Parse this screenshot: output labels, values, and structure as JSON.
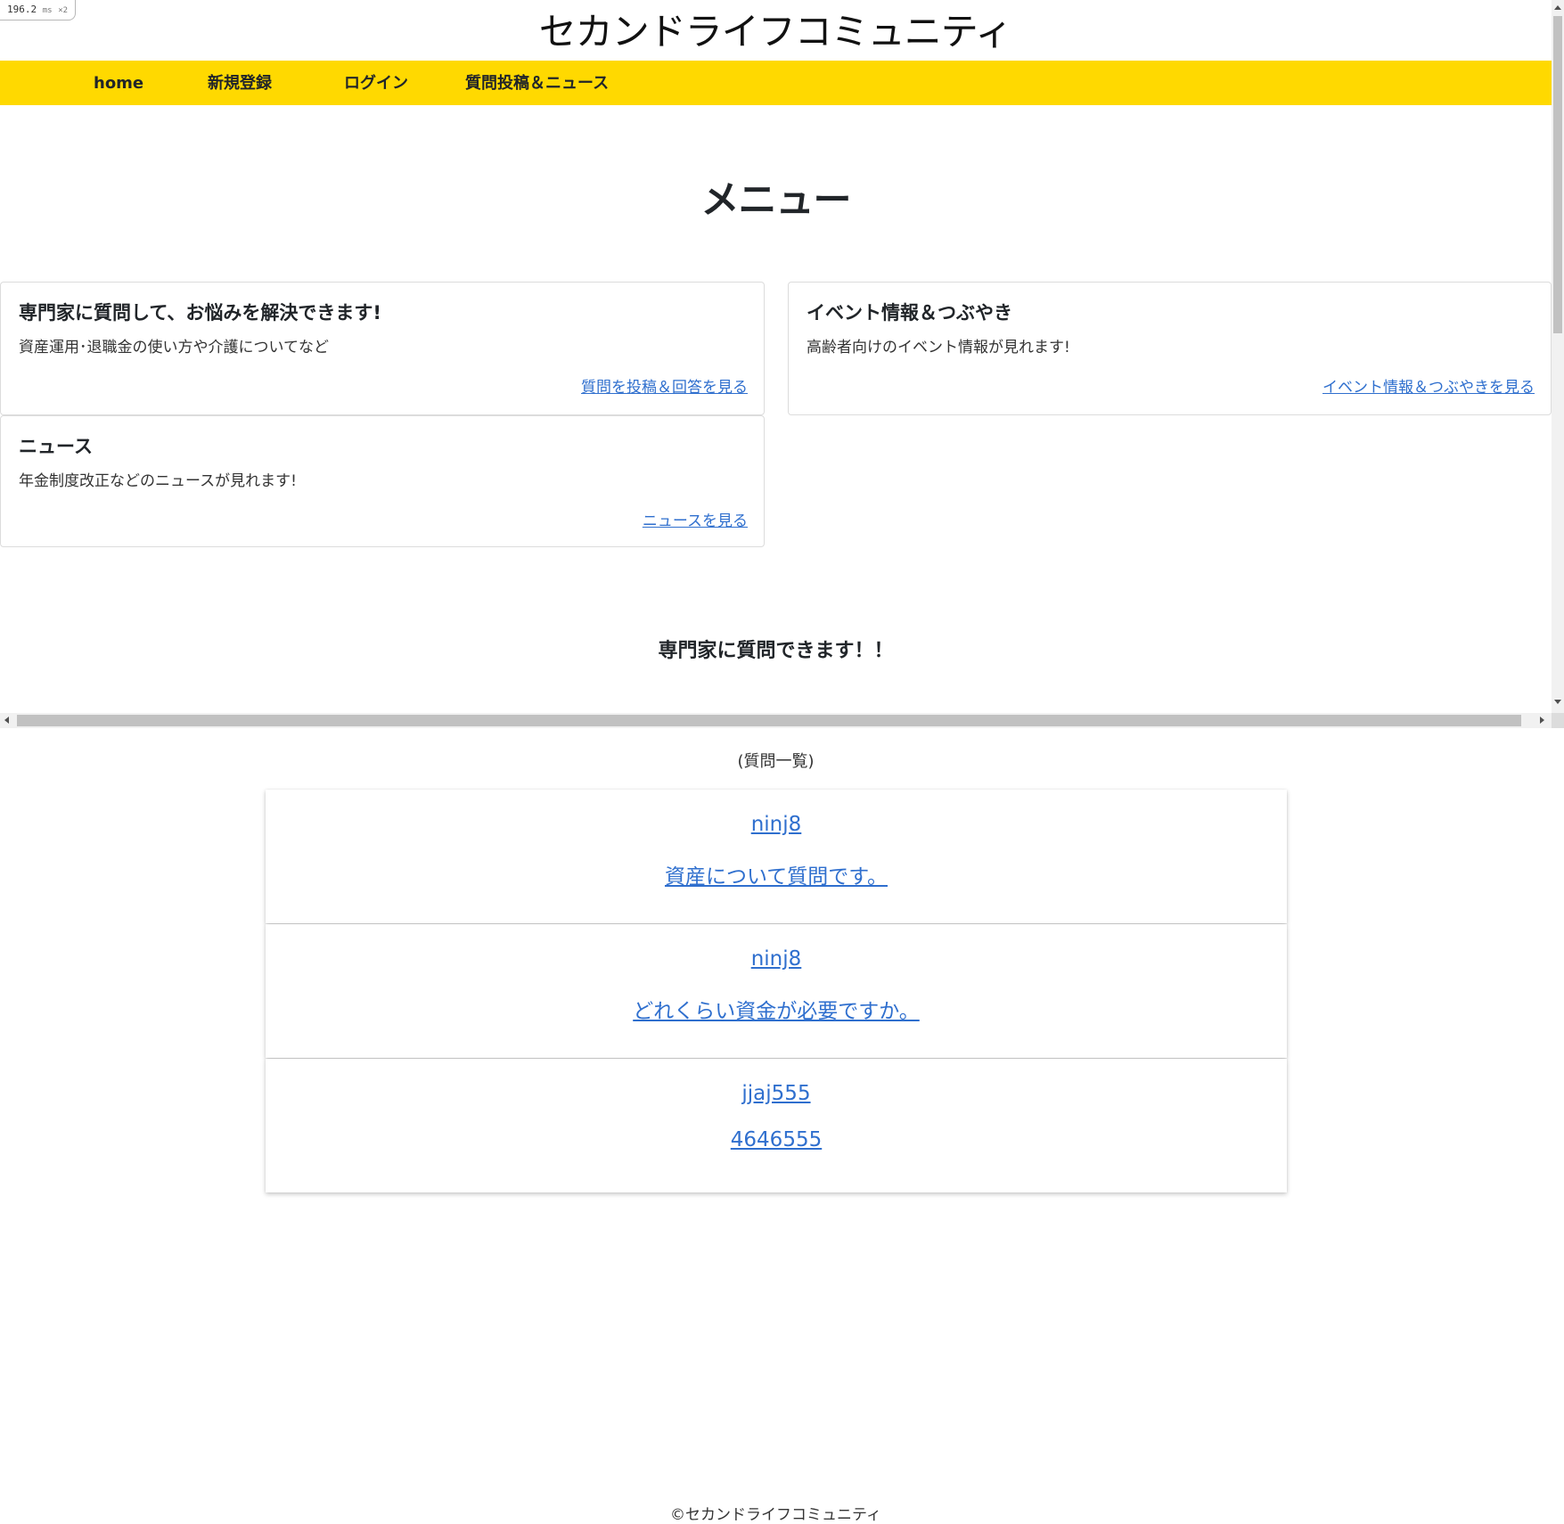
{
  "perf": {
    "value": "196.2",
    "unit": "ms",
    "multiplier": "×2"
  },
  "site": {
    "title": "セカンドライフコミュニティ"
  },
  "nav": {
    "items": [
      {
        "label": "home"
      },
      {
        "label": "新規登録"
      },
      {
        "label": "ログイン"
      },
      {
        "label": "質問投稿＆ニュース"
      }
    ]
  },
  "menu": {
    "heading": "メニュー",
    "cards": [
      {
        "title": "専門家に質問して、お悩みを解決できます!",
        "text": "資産運用･退職金の使い方や介護についてなど",
        "link": "質問を投稿＆回答を見る"
      },
      {
        "title": "イベント情報＆つぶやき",
        "text": "高齢者向けのイベント情報が見れます!",
        "link": "イベント情報＆つぶやきを見る"
      },
      {
        "title": "ニュース",
        "text": "年金制度改正などのニュースが見れます!",
        "link": "ニュースを見る"
      }
    ]
  },
  "questions": {
    "heading": "専門家に質問できます！！",
    "caption": "(質問一覧)",
    "items": [
      {
        "user": "ninj8",
        "title": "資産について質問です。"
      },
      {
        "user": "ninj8",
        "title": "どれくらい資金が必要ですか。"
      },
      {
        "user": "jjaj555",
        "title": "4646555"
      }
    ]
  },
  "footer": {
    "text": "©セカンドライフコミュニティ"
  },
  "colors": {
    "nav_bg": "#ffd900",
    "link": "#2f6fce"
  }
}
